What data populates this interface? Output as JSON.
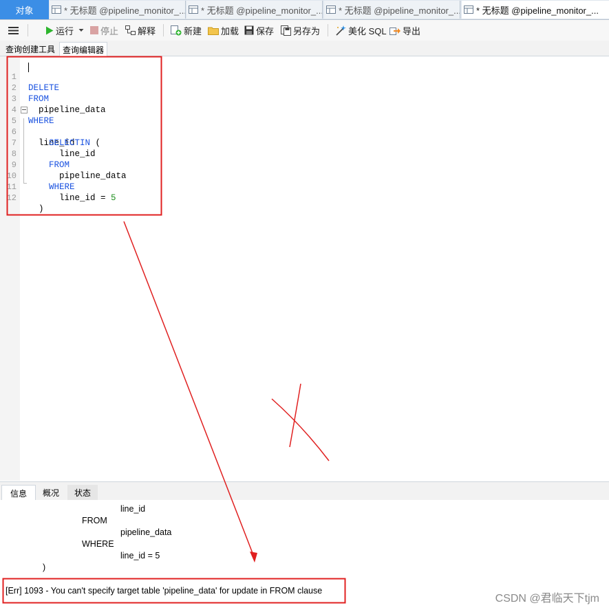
{
  "tabs": {
    "objects": "对象",
    "query_tabs": [
      "* 无标题 @pipeline_monitor_...",
      "* 无标题 @pipeline_monitor_...",
      "* 无标题 @pipeline_monitor_...",
      "* 无标题 @pipeline_monitor_..."
    ]
  },
  "toolbar": {
    "run": "运行",
    "stop": "停止",
    "explain": "解释",
    "new": "新建",
    "load": "加载",
    "save": "保存",
    "save_as": "另存为",
    "beautify": "美化 SQL",
    "export": "导出"
  },
  "subtabs": {
    "builder": "查询创建工具",
    "editor": "查询编辑器"
  },
  "editor": {
    "lines": [
      {
        "n": "1",
        "kw": "DELETE",
        "rest": ""
      },
      {
        "n": "2",
        "kw": "FROM",
        "rest": ""
      },
      {
        "n": "3",
        "kw": "",
        "rest": "  pipeline_data"
      },
      {
        "n": "4",
        "kw": "WHERE",
        "rest": ""
      },
      {
        "n": "5",
        "kw": "",
        "rest": "  line_id ",
        "kw2": "IN",
        "rest2": " ("
      },
      {
        "n": "6",
        "kw": "    SELECT",
        "rest": ""
      },
      {
        "n": "7",
        "kw": "",
        "rest": "      line_id"
      },
      {
        "n": "8",
        "kw": "    FROM",
        "rest": ""
      },
      {
        "n": "9",
        "kw": "",
        "rest": "      pipeline_data"
      },
      {
        "n": "10",
        "kw": "    WHERE",
        "rest": ""
      },
      {
        "n": "11",
        "kw": "",
        "rest": "      line_id = ",
        "num": "5"
      },
      {
        "n": "12",
        "kw": "",
        "rest": "  )"
      }
    ]
  },
  "bottom": {
    "tabs": [
      "信息",
      "概况",
      "状态"
    ],
    "messages": [
      "line_id",
      "FROM",
      "pipeline_data",
      "WHERE",
      "line_id = 5",
      ")"
    ],
    "error": "[Err] 1093 - You can't specify target table 'pipeline_data' for update in FROM clause"
  },
  "watermark": "CSDN @君临天下tjm",
  "colors": {
    "accent_tab": "#3b8ee6",
    "keyword": "#1a52e0",
    "number": "#1e8f1e",
    "annotation_red": "#e02020"
  }
}
